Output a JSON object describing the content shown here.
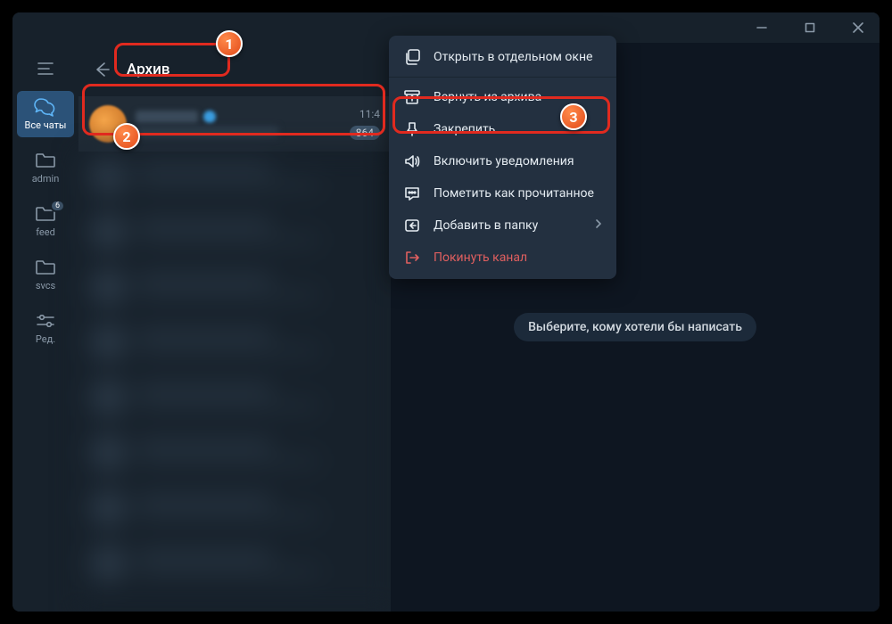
{
  "window_controls": {
    "minimize": "minimize",
    "maximize": "maximize",
    "close": "close"
  },
  "sidebar": {
    "items": [
      {
        "label": "Все чаты",
        "icon": "chats"
      },
      {
        "label": "admin",
        "icon": "folder"
      },
      {
        "label": "feed",
        "icon": "folder",
        "badge": "6"
      },
      {
        "label": "svcs",
        "icon": "folder"
      },
      {
        "label": "Ред.",
        "icon": "sliders"
      }
    ]
  },
  "archive": {
    "title": "Архив",
    "chat": {
      "time": "11:4",
      "count": "864"
    }
  },
  "context_menu": {
    "open_window": "Открыть в отдельном окне",
    "unarchive": "Вернуть из архива",
    "pin": "Закрепить",
    "notifications": "Включить уведомления",
    "mark_read": "Пометить как прочитанное",
    "add_folder": "Добавить в папку",
    "leave": "Покинуть канал"
  },
  "main": {
    "placeholder": "Выберите, кому хотели бы написать"
  }
}
